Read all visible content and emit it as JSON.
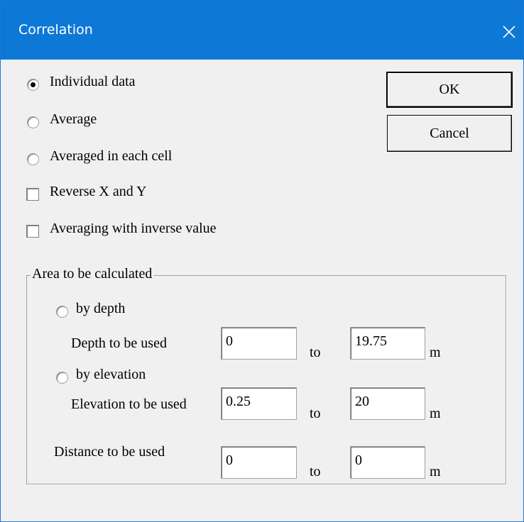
{
  "window": {
    "title": "Correlation"
  },
  "options": {
    "individual": "Individual data",
    "average": "Average",
    "averaged_cell": "Averaged in each cell",
    "reverse": "Reverse X and Y",
    "averaging_inverse": "Averaging with inverse value",
    "selected": "individual"
  },
  "buttons": {
    "ok": "OK",
    "cancel": "Cancel"
  },
  "area": {
    "label": "Area to be calculated",
    "by_depth": "by depth",
    "depth_label": "Depth to be used",
    "depth_from": "0",
    "depth_to": "19.75",
    "by_elevation": "by elevation",
    "elevation_label": "Elevation to be used",
    "elevation_from": "0.25",
    "elevation_to": "20",
    "distance_label": "Distance to be used",
    "distance_from": "0",
    "distance_to": "0",
    "to": "to",
    "unit": "m"
  },
  "colors": {
    "titlebar": "#0e78d6",
    "background": "#f0f0f0"
  }
}
